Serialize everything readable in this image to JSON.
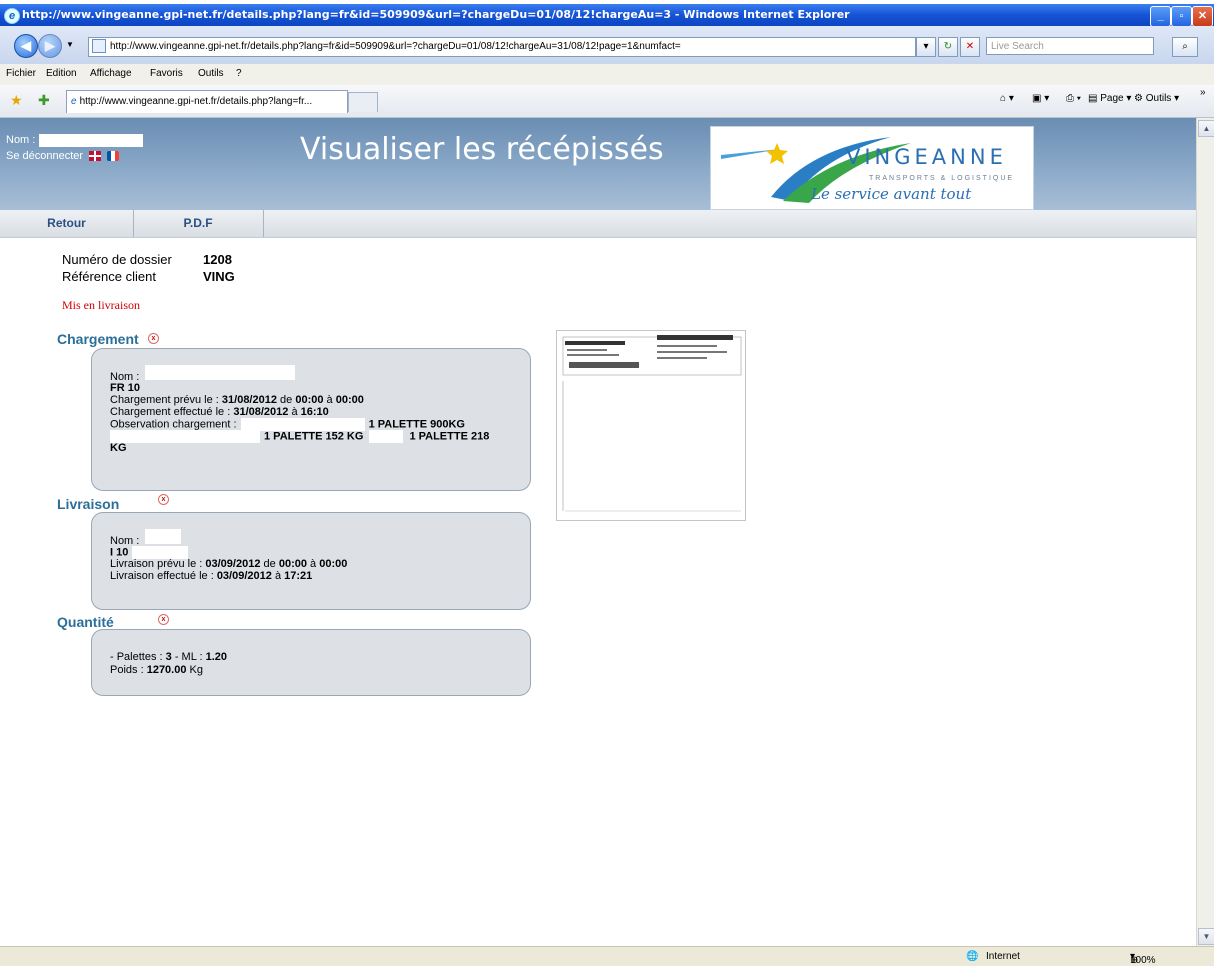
{
  "window": {
    "title": "http://www.vingeanne.gpi-net.fr/details.php?lang=fr&id=509909&url=?chargeDu=01/08/12!chargeAu=3 - Windows Internet Explorer",
    "address": "http://www.vingeanne.gpi-net.fr/details.php?lang=fr&id=509909&url=?chargeDu=01/08/12!chargeAu=31/08/12!page=1&numfact=",
    "search_placeholder": "Live Search",
    "menu": [
      "Fichier",
      "Edition",
      "Affichage",
      "Favoris",
      "Outils",
      "?"
    ],
    "tab_label": "http://www.vingeanne.gpi-net.fr/details.php?lang=fr...",
    "tools": {
      "page": "Page",
      "outils": "Outils"
    }
  },
  "header": {
    "nom_label": "Nom :",
    "logout": "Se déconnecter",
    "title": "Visualiser les récépissés",
    "logo": {
      "brand": "VINGEANNE",
      "sub": "TRANSPORTS & LOGISTIQUE",
      "tagline": "Le service avant tout"
    }
  },
  "nav": {
    "retour": "Retour",
    "pdf": "P.D.F"
  },
  "dossier": {
    "numero_label": "Numéro de dossier",
    "numero_value": "1208",
    "reference_label": "Référence client",
    "reference_value": "VING",
    "status": "Mis en livraison"
  },
  "chargement": {
    "title": "Chargement",
    "nom_label": "Nom :",
    "code": "FR 10",
    "prevu_label": "Chargement prévu le :",
    "prevu_date": "31/08/2012",
    "prevu_de": "de",
    "prevu_from": "00:00",
    "prevu_a": "à",
    "prevu_to": "00:00",
    "effectue_label": "Chargement effectué le :",
    "effectue_date": "31/08/2012",
    "effectue_a": "à",
    "effectue_time": "16:10",
    "observation_label": "Observation chargement :",
    "obs1": "1 PALETTE 900KG",
    "obs2": "1 PALETTE 152 KG",
    "obs3": "1 PALETTE 218",
    "obs4": "KG"
  },
  "livraison": {
    "title": "Livraison",
    "nom_label": "Nom :",
    "code": "I 10",
    "prevu_label": "Livraison prévu le :",
    "prevu_date": "03/09/2012",
    "prevu_de": "de",
    "prevu_from": "00:00",
    "prevu_a": "à",
    "prevu_to": "00:00",
    "effectue_label": "Livraison effectué le :",
    "effectue_date": "03/09/2012",
    "effectue_a": "à",
    "effectue_time": "17:21"
  },
  "quantite": {
    "title": "Quantité",
    "palettes_label": "- Palettes :",
    "palettes_value": "3",
    "ml_label": "- ML :",
    "ml_value": "1.20",
    "poids_label": "Poids :",
    "poids_value": "1270.00",
    "poids_unit": "Kg"
  },
  "statusbar": {
    "zone": "Internet",
    "zoom": "100%"
  }
}
